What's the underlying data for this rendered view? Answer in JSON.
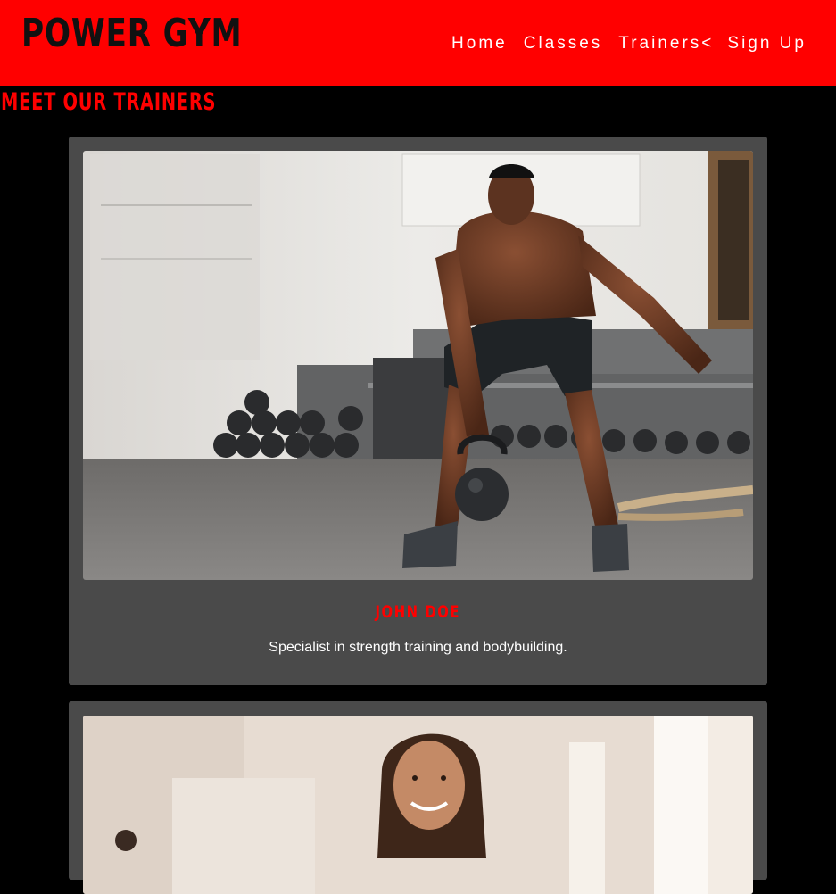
{
  "header": {
    "logo": "POWER GYM",
    "nav": [
      {
        "label": "Home"
      },
      {
        "label": "Classes"
      },
      {
        "label": "Trainers",
        "active": true
      },
      {
        "label": "Sign Up"
      }
    ],
    "stray_char": "<",
    "background_color": "#ff0000"
  },
  "main": {
    "title": "MEET OUR TRAINERS",
    "trainers": [
      {
        "name": "JOHN DOE",
        "bio": "Specialist in strength training and bodybuilding.",
        "photo_icon": "trainer-photo-kettlebell"
      },
      {
        "name": "",
        "bio": "",
        "photo_icon": "trainer-photo-smiling-woman"
      }
    ]
  },
  "colors": {
    "accent": "#ff0000",
    "card": "#4a4a4a",
    "page_bg": "#000000"
  }
}
